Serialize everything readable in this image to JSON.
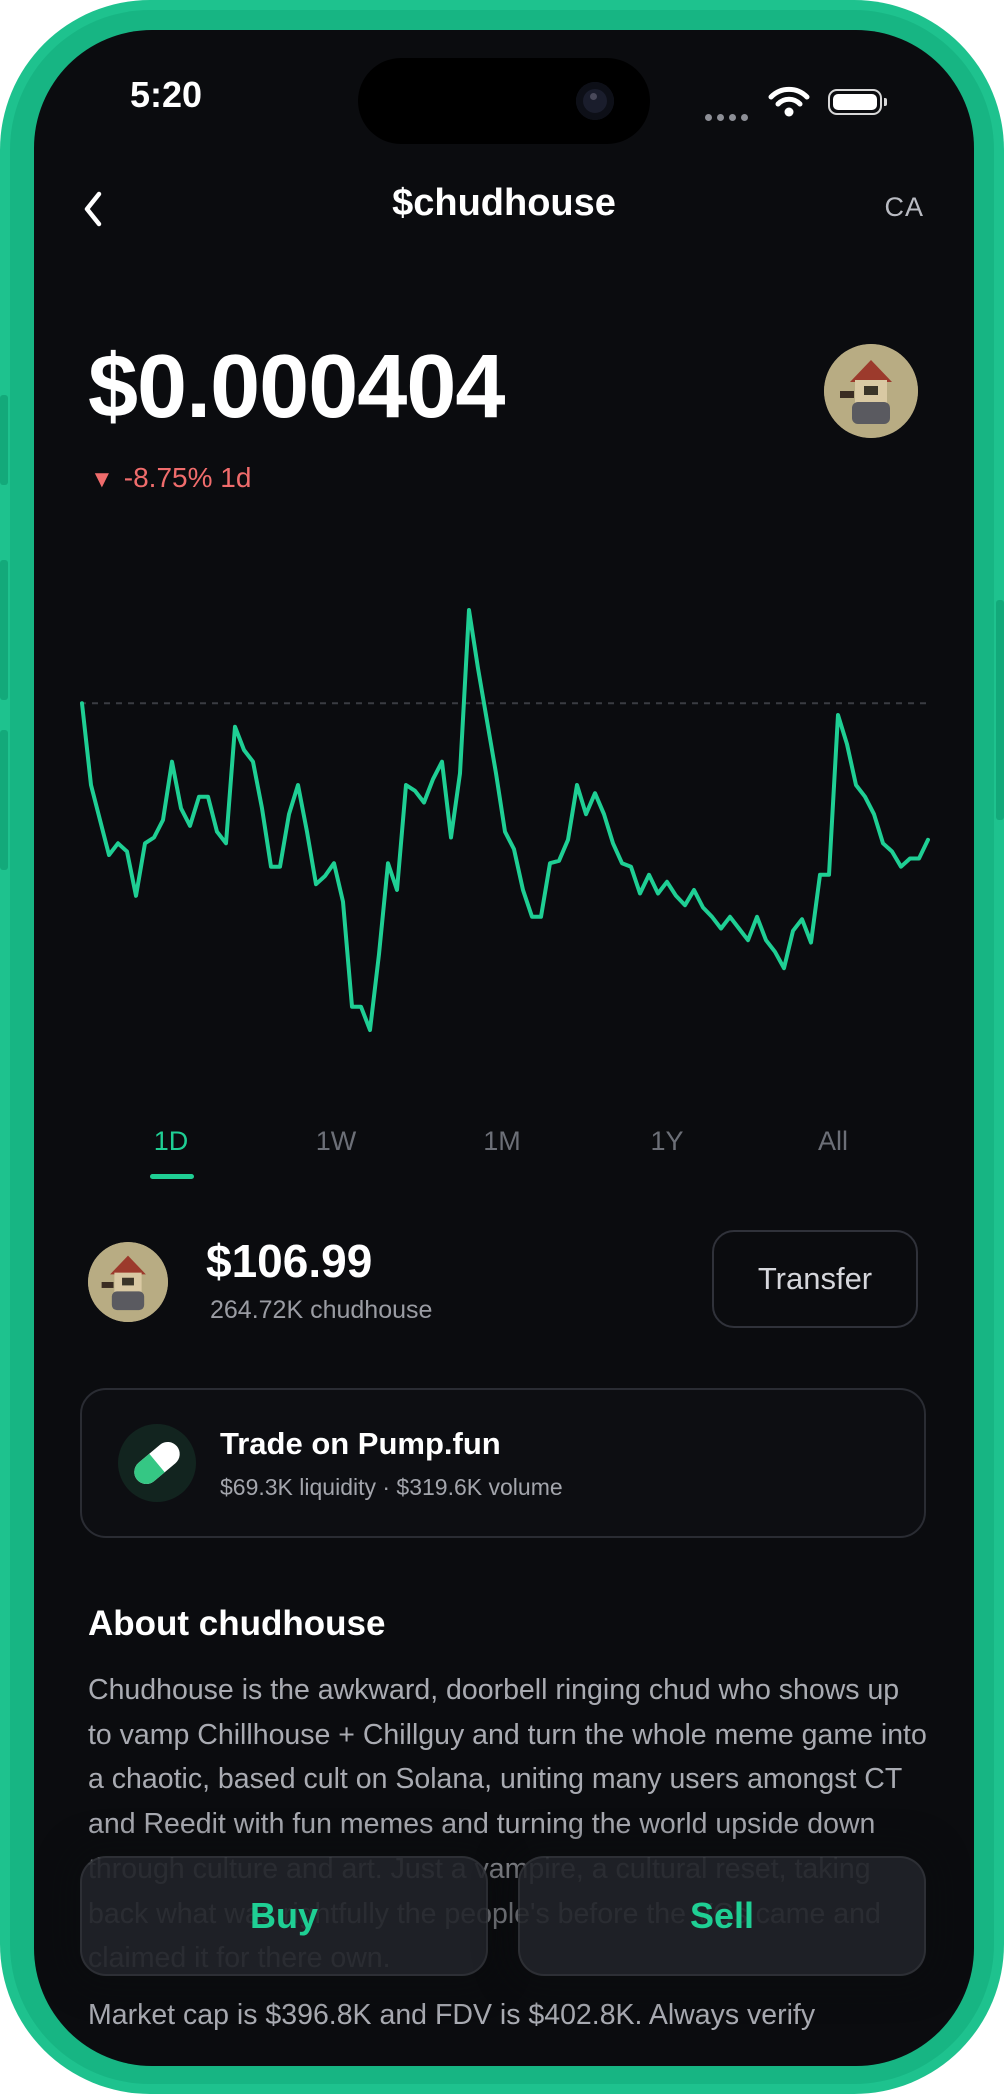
{
  "status_bar": {
    "time": "5:20"
  },
  "nav": {
    "title": "$chudhouse",
    "ca_label": "CA"
  },
  "token": {
    "price": "$0.000404",
    "change": "-8.75% 1d",
    "change_color": "#f06c6c"
  },
  "chart_data": {
    "type": "line",
    "series": [
      {
        "values": [
          0.0505,
          0.0435,
          0.0405,
          0.0375,
          0.0385,
          0.0378,
          0.034,
          0.0385,
          0.039,
          0.0405,
          0.0455,
          0.0415,
          0.04,
          0.0425,
          0.0425,
          0.0395,
          0.0385,
          0.0485,
          0.0465,
          0.0455,
          0.0415,
          0.0365,
          0.0365,
          0.041,
          0.0435,
          0.0395,
          0.035,
          0.0357,
          0.0368,
          0.0335,
          0.0245,
          0.0245,
          0.0225,
          0.029,
          0.0368,
          0.0345,
          0.0435,
          0.043,
          0.042,
          0.044,
          0.0455,
          0.039,
          0.0445,
          0.0585,
          0.0535,
          0.049,
          0.0445,
          0.0395,
          0.038,
          0.0345,
          0.0322,
          0.0322,
          0.0368,
          0.037,
          0.0388,
          0.0435,
          0.041,
          0.0428,
          0.041,
          0.0385,
          0.0368,
          0.0365,
          0.0342,
          0.0358,
          0.0342,
          0.0352,
          0.034,
          0.0332,
          0.0345,
          0.033,
          0.0322,
          0.0312,
          0.0322,
          0.0312,
          0.0302,
          0.0322,
          0.0302,
          0.0292,
          0.0278,
          0.031,
          0.032,
          0.03,
          0.0358,
          0.0358,
          0.0495,
          0.047,
          0.0435,
          0.0425,
          0.041,
          0.0385,
          0.0378,
          0.0365,
          0.0372,
          0.0372,
          0.0388
        ],
        "color": "#1fcf94"
      }
    ],
    "reference_line": "dashed (day open)",
    "grid": false
  },
  "ranges": [
    "1D",
    "1W",
    "1M",
    "1Y",
    "All"
  ],
  "active_range": "1D",
  "holding": {
    "value": "$106.99",
    "amount": "264.72K chudhouse",
    "transfer_label": "Transfer"
  },
  "trade": {
    "title": "Trade on Pump.fun",
    "subtitle": "$69.3K liquidity · $319.6K volume",
    "icon": "pill-icon"
  },
  "about": {
    "title": "About chudhouse",
    "text": "Chudhouse is the awkward, doorbell ringing chud who shows up to vamp Chillhouse + Chillguy and turn the whole meme game into a chaotic, based cult on Solana, uniting many users amongst CT and Reedit with fun memes and turning the world upside down through culture and art. Just a vampire, a cultural reset, taking back what was rightfully the people's before the VCs came and claimed it for there own.",
    "text2": "Market cap is $396.8K and FDV is $402.8K. Always verify"
  },
  "actions": {
    "buy_label": "Buy",
    "sell_label": "Sell"
  },
  "colors": {
    "accent": "#1fcf94",
    "background": "#0b0c0f",
    "frame": "#1ec28e",
    "negative": "#f06c6c"
  }
}
